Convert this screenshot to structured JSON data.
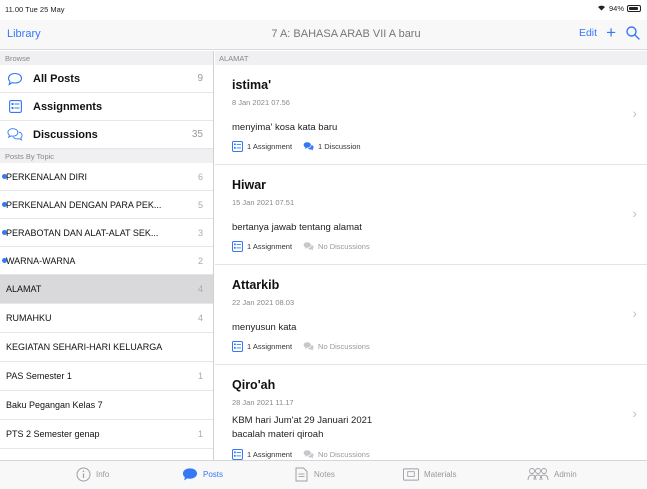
{
  "status": {
    "time": "11.00",
    "date": "Tue 25 May",
    "battery": "94%",
    "battery_level": 0.94
  },
  "nav": {
    "back": "Library",
    "title": "7 A: BAHASA ARAB VII A  baru",
    "edit": "Edit",
    "plus": "+"
  },
  "sidebar": {
    "browse_header": "Browse",
    "browse": [
      {
        "label": "All Posts",
        "count": "9",
        "icon": "speech-bubble-icon"
      },
      {
        "label": "Assignments",
        "count": "",
        "icon": "assignment-icon"
      },
      {
        "label": "Discussions",
        "count": "35",
        "icon": "discussions-icon"
      }
    ],
    "topics_header": "Posts By Topic",
    "topics": [
      {
        "label": "PERKENALAN DIRI",
        "count": "6",
        "unread": true
      },
      {
        "label": "PERKENALAN DENGAN PARA PEK...",
        "count": "5",
        "unread": true
      },
      {
        "label": "PERABOTAN DAN ALAT-ALAT SEK...",
        "count": "3",
        "unread": true
      },
      {
        "label": "WARNA-WARNA",
        "count": "2",
        "unread": true
      },
      {
        "label": "ALAMAT",
        "count": "4",
        "unread": false,
        "selected": true
      },
      {
        "label": "RUMAHKU",
        "count": "4",
        "unread": false
      },
      {
        "label": "KEGIATAN SEHARI-HARI KELUARGA",
        "count": "",
        "unread": false
      },
      {
        "label": "PAS Semester 1",
        "count": "1",
        "unread": false
      },
      {
        "label": "Baku Pegangan Kelas 7",
        "count": "",
        "unread": false
      },
      {
        "label": "PTS 2 Semester genap",
        "count": "1",
        "unread": false
      }
    ]
  },
  "main": {
    "header": "ALAMAT",
    "posts": [
      {
        "title": "istima'",
        "date": "8 Jan 2021 07.56",
        "desc": "menyima' kosa kata baru",
        "desc2": "",
        "assignments": "1 Assignment",
        "discussions": "1 Discussion",
        "has_discussion": true
      },
      {
        "title": "Hiwar",
        "date": "15 Jan 2021 07.51",
        "desc": "bertanya jawab tentang alamat",
        "desc2": "",
        "assignments": "1 Assignment",
        "discussions": "No Discussions",
        "has_discussion": false
      },
      {
        "title": "Attarkib",
        "date": "22 Jan 2021 08.03",
        "desc": "menyusun kata",
        "desc2": "",
        "assignments": "1 Assignment",
        "discussions": "No Discussions",
        "has_discussion": false
      },
      {
        "title": "Qiro'ah",
        "date": "28 Jan 2021 11.17",
        "desc": "KBM hari  Jum'at  29 Januari 2021",
        "desc2": "bacalah materi qiroah",
        "assignments": "1 Assignment",
        "discussions": "No Discussions",
        "has_discussion": false
      }
    ]
  },
  "tabbar": [
    {
      "label": "Info",
      "icon": "info-icon",
      "active": false
    },
    {
      "label": "Posts",
      "icon": "posts-bubble-icon",
      "active": true
    },
    {
      "label": "Notes",
      "icon": "notes-icon",
      "active": false
    },
    {
      "label": "Materials",
      "icon": "materials-icon",
      "active": false
    },
    {
      "label": "Admin",
      "icon": "admin-people-icon",
      "active": false
    }
  ],
  "colors": {
    "accent": "#3478f6",
    "selected_row": "#d9d9dc",
    "section_bg": "#f0f0f2"
  }
}
